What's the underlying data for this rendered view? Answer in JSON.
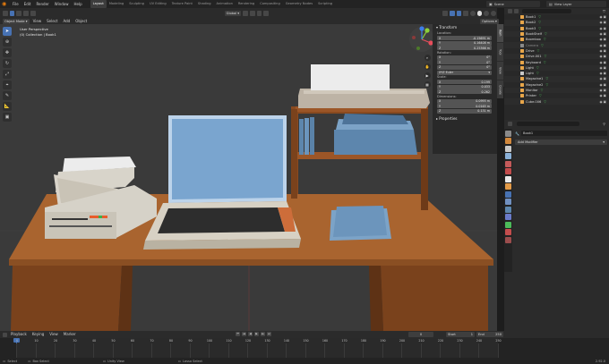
{
  "topbar": {
    "menus": [
      "File",
      "Edit",
      "Render",
      "Window",
      "Help"
    ],
    "workspaces": [
      "Layout",
      "Modeling",
      "Sculpting",
      "UV Editing",
      "Texture Paint",
      "Shading",
      "Animation",
      "Rendering",
      "Compositing",
      "Geometry Nodes",
      "Scripting"
    ],
    "active_workspace": "Layout",
    "scene_label": "Scene",
    "view_layer_label": "View Layer"
  },
  "viewport_header": {
    "mode": "Object Mode",
    "menus": [
      "View",
      "Select",
      "Add",
      "Object"
    ],
    "transform": "Global",
    "options": "Options"
  },
  "viewport": {
    "perspective": "User Perspective",
    "collection": "(0) Collection | Book1"
  },
  "npanel": {
    "section_transform": "Transform",
    "location_label": "Location:",
    "location": [
      [
        "X",
        "-0.15691 m"
      ],
      [
        "Y",
        "0.16408 m"
      ],
      [
        "Z",
        "0.25366 m"
      ]
    ],
    "rotation_label": "Rotation:",
    "rotation": [
      [
        "X",
        "0°"
      ],
      [
        "Y",
        "0°"
      ],
      [
        "Z",
        "0°"
      ]
    ],
    "rotation_mode": "XYZ Euler",
    "scale_label": "Scale:",
    "scale": [
      [
        "X",
        "0.199"
      ],
      [
        "Y",
        "0.033"
      ],
      [
        "Z",
        "0.262"
      ]
    ],
    "dimensions_label": "Dimensions:",
    "dimensions": [
      [
        "X",
        "0.0995 m"
      ],
      [
        "Y",
        "0.0165 m"
      ],
      [
        "Z",
        "0.131 m"
      ]
    ],
    "section_properties": "Properties",
    "tabs": [
      "Item",
      "Tool",
      "View",
      "Create"
    ]
  },
  "outliner": {
    "items": [
      {
        "name": "Book1",
        "color": "#e8a64a"
      },
      {
        "name": "Book2",
        "color": "#e8a64a"
      },
      {
        "name": "Book3",
        "color": "#e8a64a"
      },
      {
        "name": "BookShelf",
        "color": "#e8a64a"
      },
      {
        "name": "Boombox",
        "color": "#e8a64a"
      },
      {
        "name": "Camera",
        "color": "#8a8a8a",
        "dim": true
      },
      {
        "name": "Drive",
        "color": "#e8a64a"
      },
      {
        "name": "Drive.001",
        "color": "#e8a64a"
      },
      {
        "name": "Keyboard",
        "color": "#e8a64a"
      },
      {
        "name": "Light",
        "color": "#e8a64a"
      },
      {
        "name": "Light",
        "color": "#c9c9c9"
      },
      {
        "name": "Magazine1",
        "color": "#e8a64a"
      },
      {
        "name": "Magazine2",
        "color": "#e8a64a"
      },
      {
        "name": "Monitor",
        "color": "#e8a64a"
      },
      {
        "name": "Printer",
        "color": "#e8a64a"
      },
      {
        "name": "Cube.006",
        "color": "#e8a64a"
      }
    ]
  },
  "properties": {
    "search_placeholder": "",
    "object_name": "Book1",
    "add_modifier": "Add Modifier"
  },
  "timeline": {
    "menus": [
      "Playback",
      "Keying",
      "View",
      "Marker"
    ],
    "current_frame": "0",
    "start_label": "Start",
    "start": "1",
    "end_label": "End",
    "end": "250",
    "ticks": [
      "0",
      "10",
      "20",
      "30",
      "40",
      "50",
      "60",
      "70",
      "80",
      "90",
      "100",
      "110",
      "120",
      "130",
      "140",
      "150",
      "160",
      "170",
      "180",
      "190",
      "200",
      "210",
      "220",
      "230",
      "240",
      "250"
    ]
  },
  "statusbar": {
    "left": "Select",
    "mid1": "Box Select",
    "mid2": "Unity View",
    "mid3": "Lasso Select",
    "version": "2.92.0"
  },
  "colors": {
    "accent": "#4772b3",
    "object_orange": "#e8a64a",
    "desk": "#a9642f",
    "monitor_screen": "#7aa5cf"
  }
}
